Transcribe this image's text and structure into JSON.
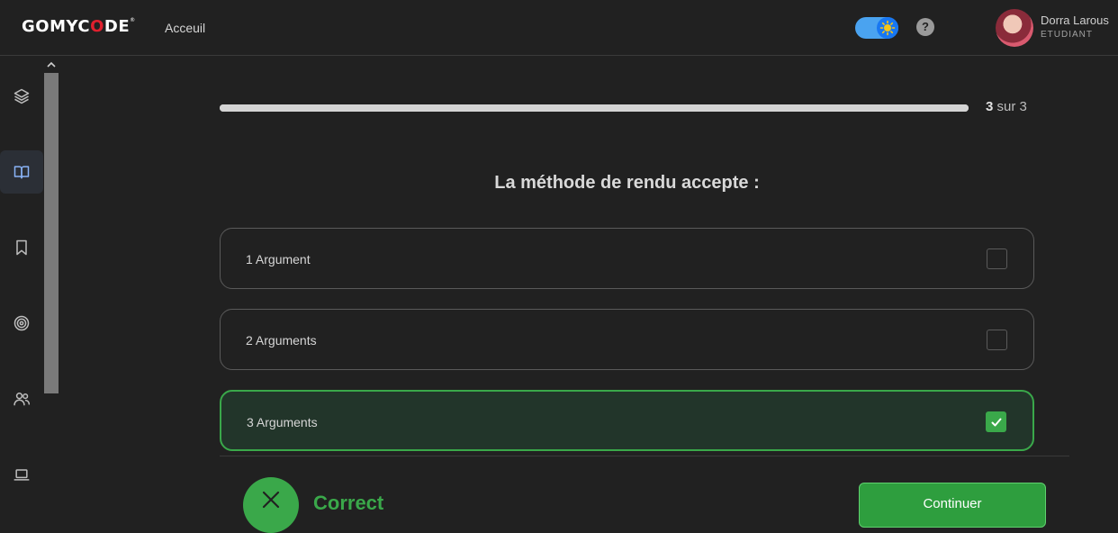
{
  "header": {
    "logo_prefix": "GOMYC",
    "logo_o": "O",
    "logo_suffix": "DE",
    "logo_reg": "®",
    "home_link": "Acceuil",
    "help_label": "?",
    "user_name": "Dorra Larous",
    "user_role": "ETUDIANT",
    "theme_toggle_on": true
  },
  "sidebar": {
    "items": [
      {
        "icon": "layers-icon"
      },
      {
        "icon": "book-icon",
        "active": true
      },
      {
        "icon": "bookmark-icon"
      },
      {
        "icon": "target-icon"
      },
      {
        "icon": "users-icon"
      },
      {
        "icon": "laptop-icon"
      }
    ]
  },
  "quiz": {
    "progress_current": "3",
    "progress_suffix": "sur 3",
    "progress_fraction": 1.0,
    "question": "La méthode de rendu accepte :",
    "options": [
      {
        "label": "1 Argument",
        "checked": false
      },
      {
        "label": "2 Arguments",
        "checked": false
      },
      {
        "label": "3 Arguments",
        "checked": true
      }
    ],
    "result_text": "Correct",
    "continue_label": "Continuer"
  },
  "colors": {
    "background": "#212121",
    "success": "#3aa84a",
    "accent_blue": "#1877f2",
    "brand_red": "#e0202e"
  }
}
